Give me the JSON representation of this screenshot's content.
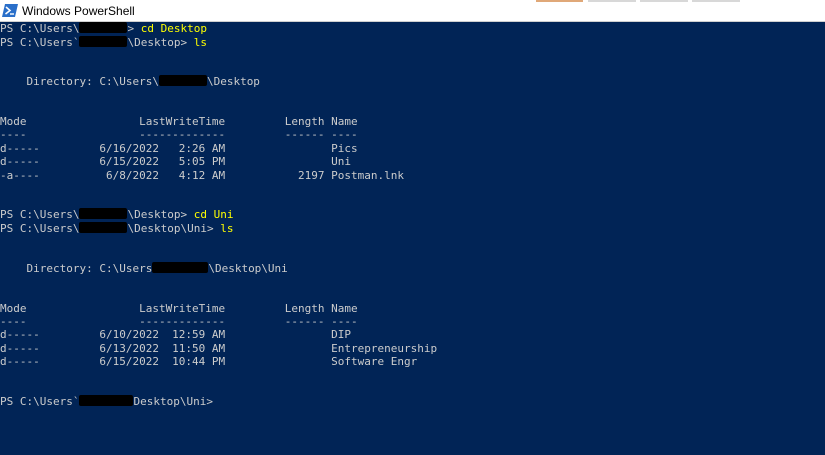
{
  "window": {
    "title": "Windows PowerShell",
    "icon": "powershell-icon"
  },
  "colors": {
    "background": "#012456",
    "text": "#cccccc",
    "command": "#ffff00",
    "titlebar": "#ffffff"
  },
  "terminal": {
    "prompt1": {
      "before": "PS C:\\Users\\",
      "after": "> ",
      "command": "cd Desktop"
    },
    "prompt2": {
      "before": "PS C:\\Users`",
      "after": "\\Desktop> ",
      "command": "ls"
    },
    "dir1": {
      "before": "    Directory: C:\\Users\\",
      "after": "\\Desktop"
    },
    "header1": "Mode                 LastWriteTime         Length Name",
    "underline1": "----                 -------------         ------ ----",
    "rows1": [
      "d-----         6/16/2022   2:26 AM                Pics",
      "d-----         6/15/2022   5:05 PM                Uni",
      "-a----          6/8/2022   4:12 AM           2197 Postman.lnk"
    ],
    "prompt3": {
      "before": "PS C:\\Users\\",
      "after": "\\Desktop> ",
      "command": "cd Uni"
    },
    "prompt4": {
      "before": "PS C:\\Users\\",
      "after": "\\Desktop\\Uni> ",
      "command": "ls"
    },
    "dir2": {
      "before": "    Directory: C:\\Users",
      "after": "\\Desktop\\Uni"
    },
    "header2": "Mode                 LastWriteTime         Length Name",
    "underline2": "----                 -------------         ------ ----",
    "rows2": [
      "d-----         6/10/2022  12:59 AM                DIP",
      "d-----         6/13/2022  11:50 AM                Entrepreneurship",
      "d-----         6/15/2022  10:44 PM                Software Engr"
    ],
    "prompt5": {
      "before": "PS C:\\Users`",
      "after": "Desktop\\Uni>",
      "command": ""
    }
  }
}
